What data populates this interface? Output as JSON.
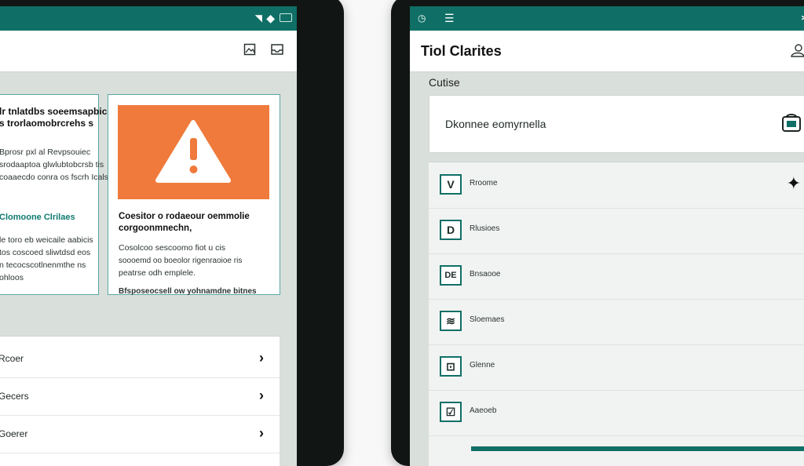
{
  "left_tablet": {
    "section_label": "",
    "info_card": {
      "title_lines": [
        "lr tnlatdbs soeemsapbicla",
        "s trorlaomobrcrehs s"
      ],
      "body_lines": [
        "Bprosr pxl al Revpsouiec",
        "srodaaptoa glwlubtobcrsb tis",
        "coaaecdo conra os fscrh Icalse"
      ],
      "link": "Clomoone Clrilaes",
      "body2_lines": [
        "le toro eb weicaile aabicis",
        "tos coscoed sliwtdsd eos",
        "n tecocscotlnenmthe ns",
        "ohloos"
      ]
    },
    "warning_card": {
      "title_lines": [
        "Coesitor o rodaeour oemmolie",
        "corgoonmnechn,"
      ],
      "body_lines": [
        "Cosolcoo sescoomo fiot u cis",
        "soooemd oo boeolor rigenraoioe ris",
        "peatrse odh emplele."
      ],
      "footer": "Bfsposeocsell ow yohnamdne bitnes"
    },
    "list_items": [
      {
        "label": "Rcoer"
      },
      {
        "label": "Gecers"
      },
      {
        "label": "Goerer"
      }
    ],
    "chevron": "›"
  },
  "right_tablet": {
    "title": "Tiol Clarites",
    "section_label": "Cutise",
    "search_text": "Dkonnee eomyrnella",
    "categories": [
      {
        "icon": "V",
        "label": "Rroome"
      },
      {
        "icon": "D",
        "label": "Rlusioes"
      },
      {
        "icon": "DE",
        "label": "Bnsaooe"
      },
      {
        "icon": "≋",
        "label": "Sloemaes"
      },
      {
        "icon": "⊡",
        "label": "Glenne"
      },
      {
        "icon": "☑",
        "label": "Aaeoeb"
      }
    ]
  },
  "colors": {
    "accent": "#0f6f66",
    "warning": "#ef7a3b",
    "card_border": "#5aa7a3"
  }
}
